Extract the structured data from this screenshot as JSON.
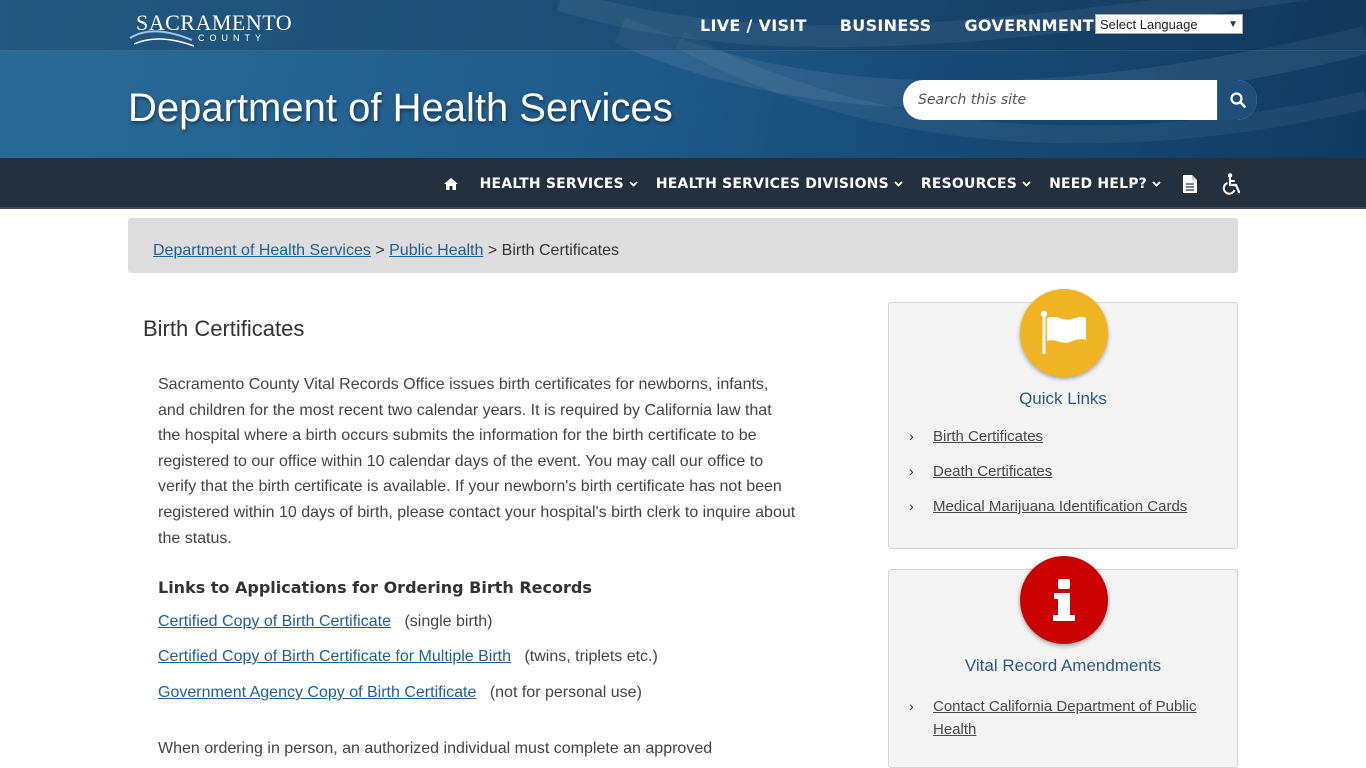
{
  "site": {
    "logo_word": "SACRAMENTO",
    "logo_sub": "COUNTY",
    "top_nav": [
      "LIVE / VISIT",
      "BUSINESS",
      "GOVERNMENT"
    ],
    "language_select": "Select Language",
    "dept_title": "Department of Health Services",
    "search_placeholder": "Search this site"
  },
  "main_nav": {
    "home_icon": "home-icon",
    "items": [
      "HEALTH SERVICES",
      "HEALTH SERVICES DIVISIONS",
      "RESOURCES",
      "NEED HELP?"
    ],
    "doc_icon": "document-icon",
    "access_icon": "accessibility-icon"
  },
  "breadcrumb": {
    "items": [
      "Department of Health Services",
      "Public Health"
    ],
    "separator": ">",
    "current": "Birth Certificates"
  },
  "content": {
    "title": "Birth Certificates",
    "intro": "Sacramento County Vital Records Office issues birth certificates for newborns, infants, and children for the most recent two calendar years. It is required by California law that the hospital where a birth occurs submits the information for the birth certificate to be registered to our office within 10 calendar days of the event. You may call our office to verify that the birth certificate is available. If your newborn's birth certificate has not been registered within 10 days of birth, please contact your hospital's birth clerk to inquire about the status.",
    "links_heading": "Links to Applications for Ordering Birth Records",
    "applications": [
      {
        "link": "Certified Copy of Birth Certificate",
        "note": "(single birth)"
      },
      {
        "link": "Certified Copy of Birth Certificate for Multiple Birth",
        "note": "(twins, triplets etc.)"
      },
      {
        "link": "Government Agency Copy of Birth Certificate",
        "note": "(not for personal use)"
      }
    ],
    "bottom_text": "When ordering in person, an authorized individual must complete an approved"
  },
  "sidebar": {
    "quick_links": {
      "title": "Quick Links",
      "icon": "flag-icon",
      "icon_color": "#f0b323",
      "items": [
        "Birth Certificates",
        "Death Certificates",
        "Medical Marijuana Identification Cards"
      ]
    },
    "amendments": {
      "title": "Vital Record Amendments",
      "icon": "info-icon",
      "icon_color": "#cc0000",
      "items": [
        "Contact California Department of Public Health"
      ]
    }
  },
  "colors": {
    "header_blue": "#1f5b8a",
    "nav_dark": "#25303f",
    "link_blue": "#1f5f97",
    "breadcrumb_bg": "#dddddd"
  }
}
